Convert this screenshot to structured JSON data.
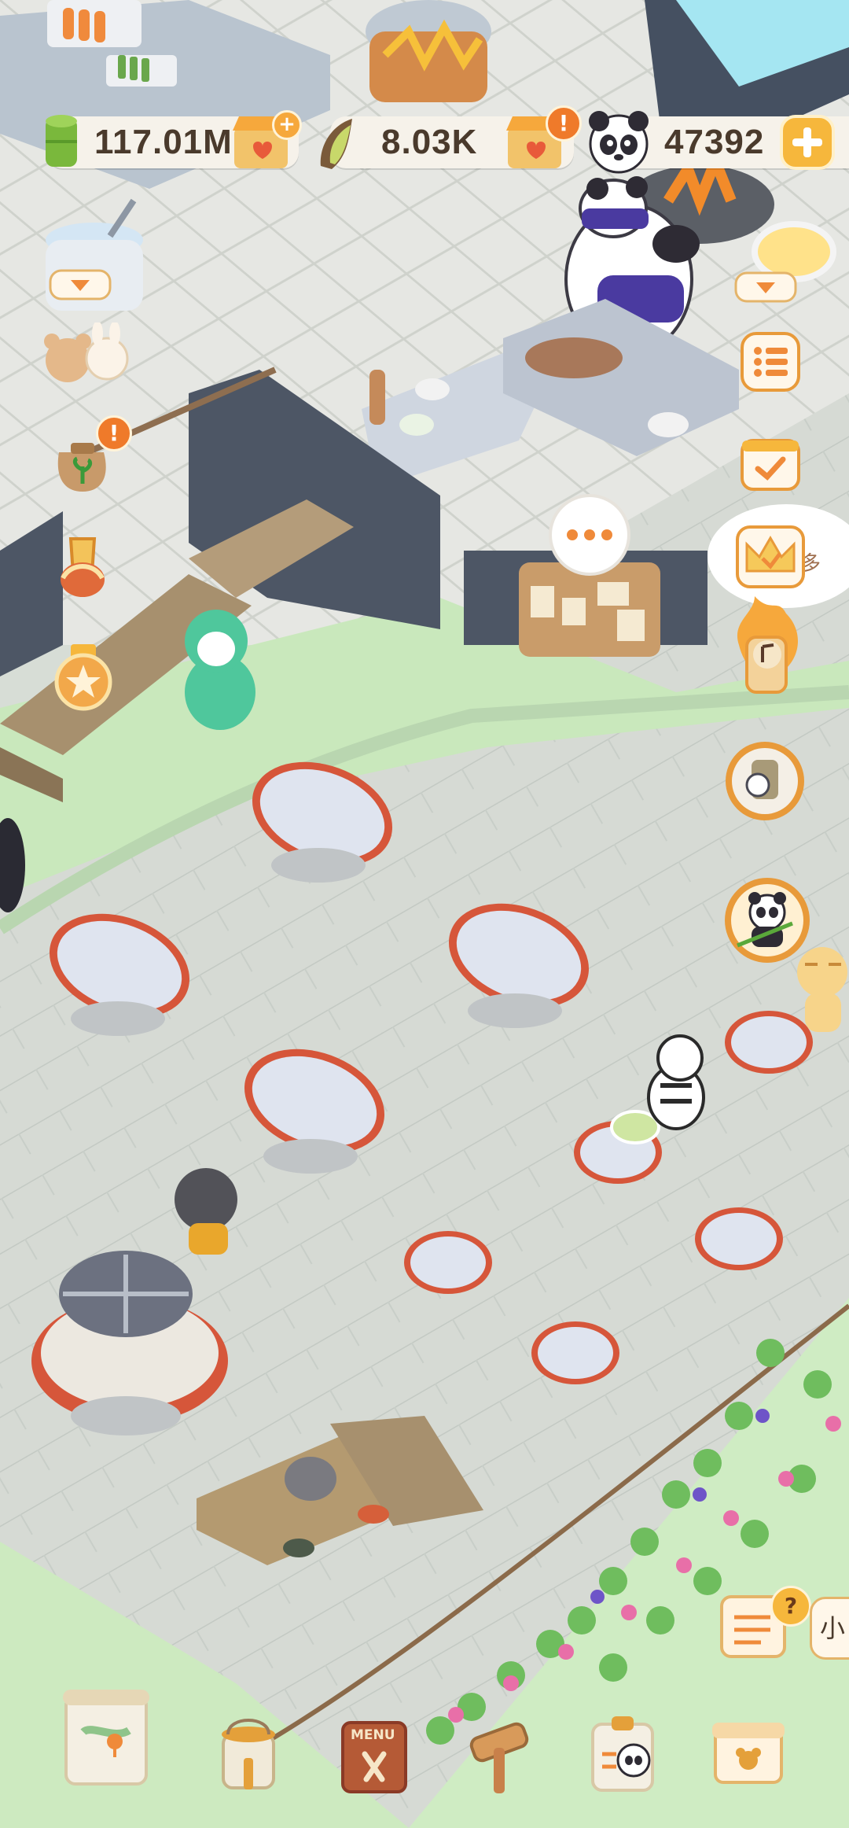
{
  "hud": {
    "currency_bamboo": "117.01M",
    "currency_shoot": "8.03K",
    "currency_panda": "47392"
  },
  "side_labels": {
    "speech_fragment": "多",
    "bottom_right_tag": "小"
  },
  "menu_sign_text": "MENU",
  "icons": {
    "bamboo": "bamboo-currency-icon",
    "shoot": "bamboo-shoot-icon",
    "panda": "panda-face-icon",
    "shop": "shop-stall-icon",
    "plus": "plus-icon",
    "alert": "exclamation-badge-icon",
    "question": "question-badge-icon"
  },
  "colors": {
    "accent_orange": "#e89a3a",
    "badge_orange": "#ef7a2a",
    "floor": "#d6dad4",
    "grass": "#c7e7b6",
    "table_top": "#dfe4ef",
    "table_rim": "#d6563a"
  }
}
